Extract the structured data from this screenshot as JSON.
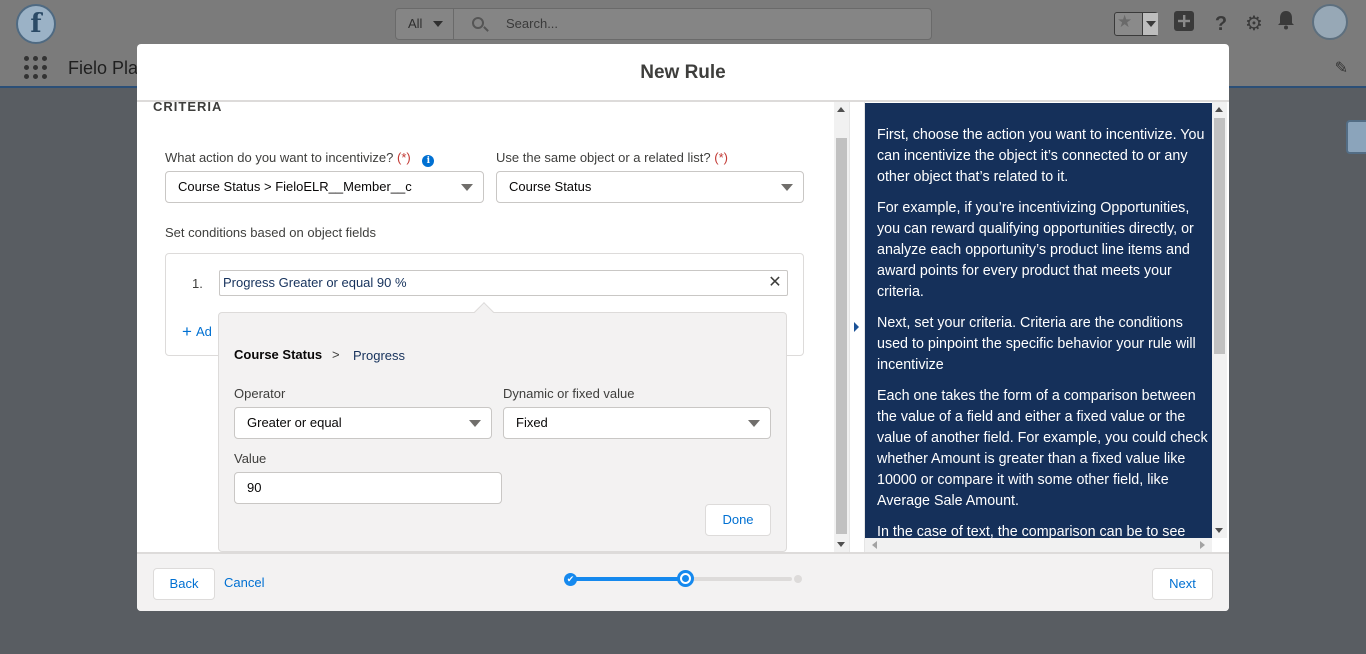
{
  "app": {
    "logo_letter": "f",
    "search_scope": "All",
    "search_placeholder": "Search...",
    "app_name": "Fielo Pla"
  },
  "modal": {
    "title": "New Rule",
    "section_title": "CRITERIA",
    "action_question": "What action do you want to incentivize?",
    "required_mark": "(*)",
    "info_glyph": "i",
    "action_value": "Course Status > FieloELR__Member__c",
    "object_question": "Use the same object or a related list?",
    "object_value": "Course Status",
    "conditions_label": "Set conditions based on object fields",
    "condition": {
      "number": "1.",
      "text": "Progress Greater or equal 90 %",
      "remove_glyph": "✕"
    },
    "add_link": "Ad",
    "popover": {
      "crumb_object": "Course Status",
      "crumb_separator": ">",
      "crumb_field": "Progress",
      "operator_label": "Operator",
      "operator_value": "Greater or equal",
      "dynamic_label": "Dynamic or fixed value",
      "dynamic_value": "Fixed",
      "value_label": "Value",
      "value_value": "90",
      "done_label": "Done"
    },
    "help_paragraphs": [
      "First, choose the action you want to incentivize. You can incentivize the object it’s connected to or any other object that’s related to it.",
      "For example, if you’re incentivizing Opportunities, you can reward qualifying opportunities directly, or analyze each opportunity’s product line items and award points for every product that meets your criteria.",
      "Next, set your criteria. Criteria are the conditions used to pinpoint the specific behavior your rule will incentivize",
      "Each one takes the form of a comparison between the value of a field and either a fixed value or the value of another field. For example, you could check whether Amount is greater than a fixed value like 10000 or compare it with some other field, like Average Sale Amount.",
      "In the case of text, the comparison can be to see"
    ],
    "footer": {
      "back_label": "Back",
      "cancel_label": "Cancel",
      "next_label": "Next",
      "check_glyph": "✔",
      "progress_fraction": 0.5
    }
  },
  "colors": {
    "brand": "#0070d2",
    "help_bg": "#15305a",
    "progress": "#1589ee",
    "required": "#c23934"
  },
  "icons": [
    "fielo-logo-icon",
    "search-icon",
    "favorites-star-icon",
    "add-icon",
    "help-icon",
    "setup-gear-icon",
    "notifications-bell-icon",
    "user-avatar-icon",
    "app-launcher-icon",
    "edit-pencil-icon",
    "info-icon",
    "chevron-down-icon",
    "close-icon",
    "add-icon",
    "check-icon"
  ]
}
